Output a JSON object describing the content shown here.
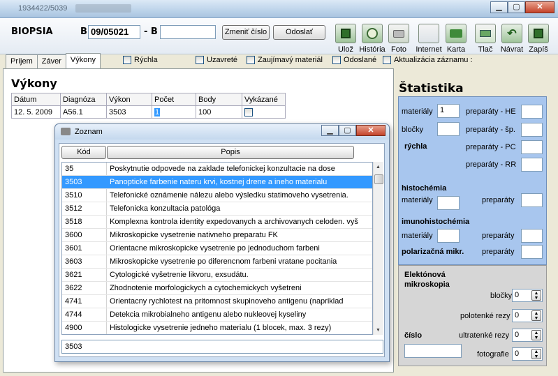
{
  "window": {
    "title_fragment": "1934422/5039"
  },
  "topbar": {
    "form_label": "BIOPSIA",
    "b_prefix": "B",
    "b_number": "09/05021",
    "dash_b": "- B",
    "b_second": "",
    "change_number_label": "Zmeniť číslo",
    "send_label": "Odoslať"
  },
  "toolbar": [
    {
      "label": "Ulož",
      "icon": "save-icon"
    },
    {
      "label": "História",
      "icon": "history-icon"
    },
    {
      "label": "Foto",
      "icon": "camera-icon"
    },
    {
      "label": "Internet",
      "icon": "internet-icon"
    },
    {
      "label": "Karta",
      "icon": "folder-icon"
    },
    {
      "label": "Tlač",
      "icon": "print-icon"
    },
    {
      "label": "Návrat",
      "icon": "return-icon"
    },
    {
      "label": "Zapíš",
      "icon": "save-write-icon"
    }
  ],
  "tabs": [
    "Príjem",
    "Záver",
    "Výkony"
  ],
  "active_tab": "Výkony",
  "checkboxes": [
    "Rýchla",
    "Uzavreté",
    "Zaujímavý materiál",
    "Odoslané",
    "Aktualizácia záznamu :"
  ],
  "vykony": {
    "title": "Výkony",
    "columns": [
      "Dátum",
      "Diagnóza",
      "Výkon",
      "Počet",
      "Body",
      "Vykázané"
    ],
    "row": {
      "datum": "12. 5. 2009",
      "diagnoza": "A56.1",
      "vykon": "3503",
      "pocet": "1",
      "body": "100"
    }
  },
  "statistika": {
    "title": "Štatistika",
    "materialy_label": "materiály",
    "materialy_value": "1",
    "blocky_label": "bločky",
    "rychla_label": "rýchla",
    "prep_he": "preparáty - HE",
    "prep_sp": "preparáty - šp.",
    "prep_pc": "preparáty - PC",
    "prep_rr": "preparáty - RR",
    "histochemia": "histochémia",
    "imunohistochemia": "imunohistochémia",
    "materialy2": "materiály",
    "preparaty": "preparáty",
    "polarizacna": "polarizačná mikr.",
    "elektronova": "Elektónová mikroskopia",
    "blocky2": "bločky",
    "polotenke": "polotenké rezy",
    "ultratenke": "ultratenké rezy",
    "fotografie": "fotografie",
    "cislo": "číslo",
    "zero": "0"
  },
  "dialog": {
    "title": "Zoznam",
    "col_kod": "Kód",
    "col_popis": "Popis",
    "rows": [
      {
        "kod": "35",
        "popis": "Poskytnutie odpovede na zaklade telefonickej konzultacie na dose"
      },
      {
        "kod": "3503",
        "popis": "Panopticke farbenie nateru krvi, kostnej drene a ineho materialu"
      },
      {
        "kod": "3510",
        "popis": "Telefonické oznámenie nálezu alebo výsledku statimoveho vysetrenia."
      },
      {
        "kod": "3512",
        "popis": "Telefonicka konzultacia patológa"
      },
      {
        "kod": "3518",
        "popis": "Komplexna kontrola identity expedovanych a archivovanych celoden. vyš"
      },
      {
        "kod": "3600",
        "popis": "Mikroskopicke vysetrenie nativneho preparatu FK"
      },
      {
        "kod": "3601",
        "popis": "Orientacne mikroskopicke vysetrenie po jednoduchom farbeni"
      },
      {
        "kod": "3603",
        "popis": "Mikroskopicke vysetrenie po diferencnom farbeni vratane pocitania"
      },
      {
        "kod": "3621",
        "popis": "Cytologické vyšetrenie likvoru, exsudátu."
      },
      {
        "kod": "3622",
        "popis": "Zhodnotenie morfologickych a cytochemickych vyšetreni"
      },
      {
        "kod": "4741",
        "popis": "Orientacny rychlotest na pritomnost skupinoveho antigenu (napriklad"
      },
      {
        "kod": "4744",
        "popis": "Detekcia mikrobialneho antigenu alebo nukleovej kyseliny"
      },
      {
        "kod": "4900",
        "popis": "Histologicke vysetrenie jedneho materialu (1 blocek, max. 3 rezy)"
      }
    ],
    "selected_index": 1,
    "search_value": "3503"
  }
}
